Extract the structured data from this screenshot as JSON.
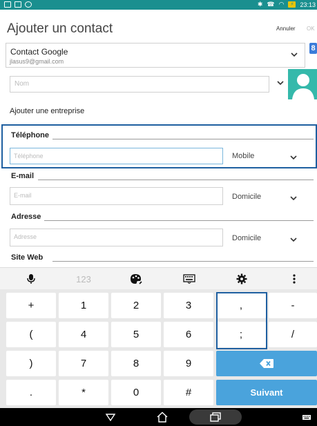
{
  "status_bar": {
    "time": "23:13"
  },
  "header": {
    "title": "Ajouter un contact",
    "cancel_label": "Annuler",
    "ok_label": "OK"
  },
  "account": {
    "name": "Contact Google",
    "email": "jlasus9@gmail.com",
    "google_badge": "8"
  },
  "name_field": {
    "placeholder": "Nom"
  },
  "add_company_label": "Ajouter une entreprise",
  "phone": {
    "section_label": "Téléphone",
    "placeholder": "Téléphone",
    "type": "Mobile"
  },
  "email": {
    "section_label": "E-mail",
    "placeholder": "E-mail",
    "type": "Domicile"
  },
  "address": {
    "section_label": "Adresse",
    "placeholder": "Adresse",
    "type": "Domicile"
  },
  "website": {
    "section_label": "Site Web"
  },
  "keyboard_toolbar": {
    "numbers_label": "123"
  },
  "keyboard": {
    "rows": [
      [
        "+",
        "1",
        "2",
        "3",
        ",",
        "-"
      ],
      [
        "(",
        "4",
        "5",
        "6",
        ";",
        "/"
      ],
      [
        ")",
        "7",
        "8",
        "9"
      ],
      [
        ".",
        "*",
        "0",
        "#"
      ]
    ],
    "next_label": "Suivant"
  },
  "colors": {
    "accent": "#1a8f8f",
    "highlight": "#1e5fa0",
    "key_blue": "#4aa3dc",
    "photo": "#35b9ab"
  }
}
